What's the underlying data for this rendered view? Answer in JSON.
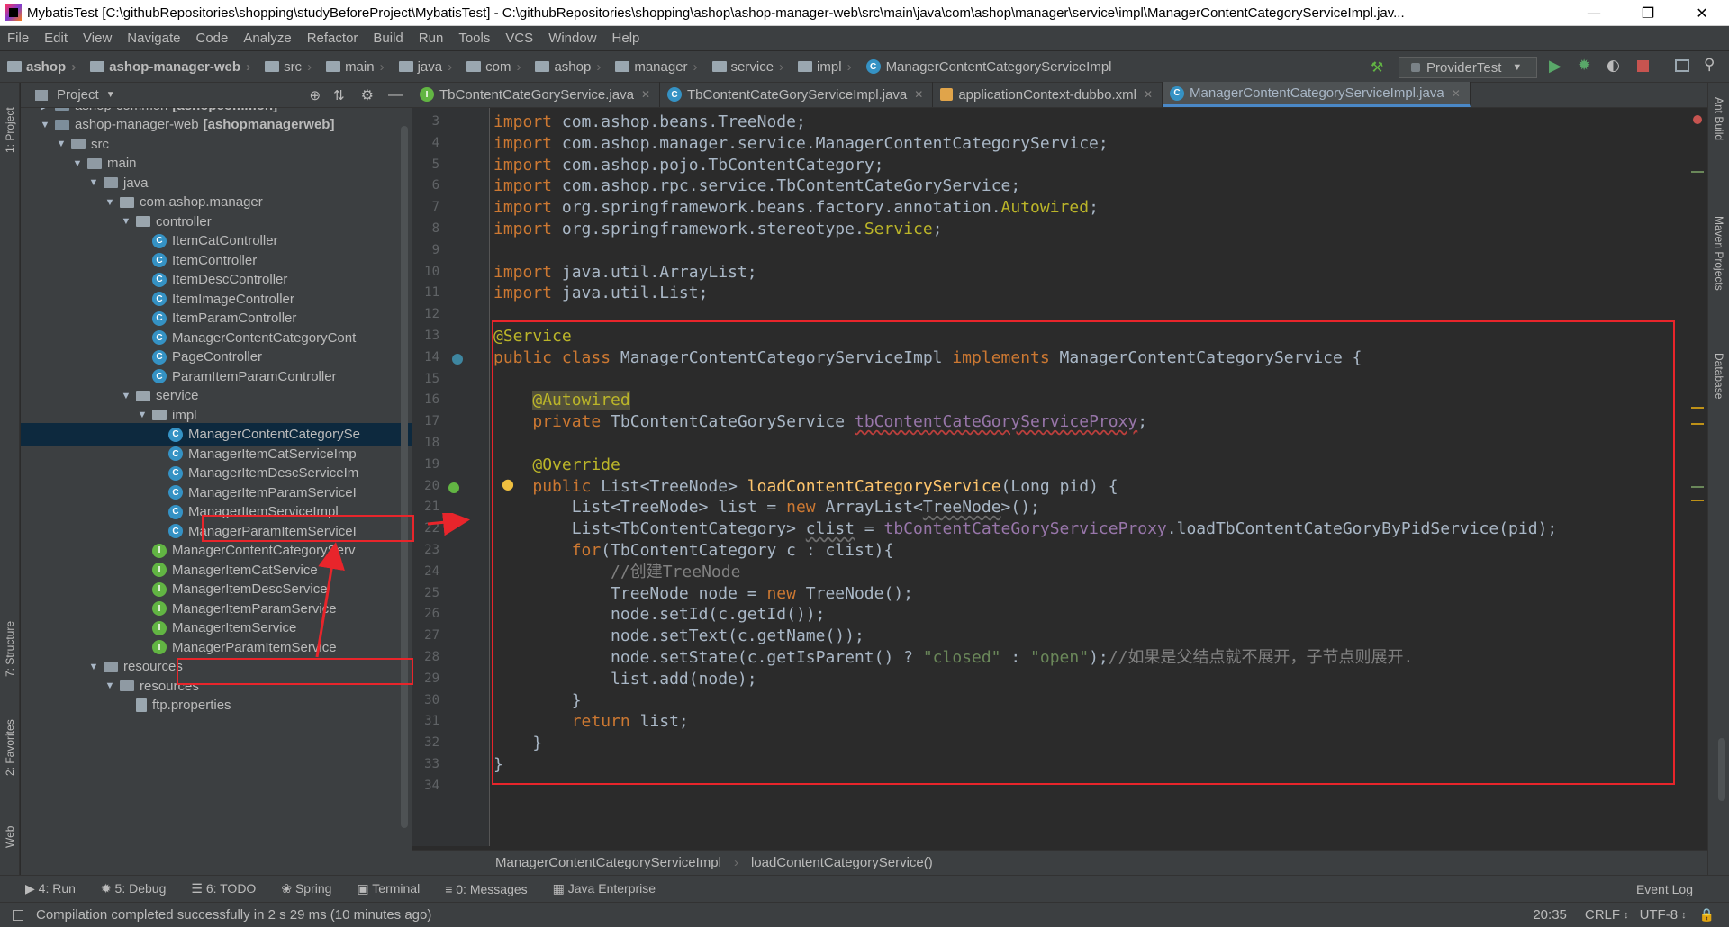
{
  "window": {
    "title": "MybatisTest [C:\\githubRepositories\\shopping\\studyBeforeProject\\MybatisTest] - C:\\githubRepositories\\shopping\\ashop\\ashop-manager-web\\src\\main\\java\\com\\ashop\\manager\\service\\impl\\ManagerContentCategoryServiceImpl.jav..."
  },
  "menu": [
    "File",
    "Edit",
    "View",
    "Navigate",
    "Code",
    "Analyze",
    "Refactor",
    "Build",
    "Run",
    "Tools",
    "VCS",
    "Window",
    "Help"
  ],
  "breadcrumbs": [
    "ashop",
    "ashop-manager-web",
    "src",
    "main",
    "java",
    "com",
    "ashop",
    "manager",
    "service",
    "impl",
    "ManagerContentCategoryServiceImpl"
  ],
  "run_config": "ProviderTest",
  "project_panel": {
    "title": "Project",
    "tree": [
      {
        "label": "ashop-common",
        "suffix": "[ashopcommon]",
        "depth": 0,
        "arrow": "right",
        "icon": "module"
      },
      {
        "label": "ashop-manager-web",
        "suffix": "[ashopmanagerweb]",
        "depth": 0,
        "arrow": "down",
        "icon": "module"
      },
      {
        "label": "src",
        "depth": 1,
        "arrow": "down",
        "icon": "folder"
      },
      {
        "label": "main",
        "depth": 2,
        "arrow": "down",
        "icon": "folder"
      },
      {
        "label": "java",
        "depth": 3,
        "arrow": "down",
        "icon": "folder"
      },
      {
        "label": "com.ashop.manager",
        "depth": 4,
        "arrow": "down",
        "icon": "package"
      },
      {
        "label": "controller",
        "depth": 5,
        "arrow": "down",
        "icon": "package"
      },
      {
        "label": "ItemCatController",
        "depth": 6,
        "icon": "class"
      },
      {
        "label": "ItemController",
        "depth": 6,
        "icon": "class"
      },
      {
        "label": "ItemDescController",
        "depth": 6,
        "icon": "class"
      },
      {
        "label": "ItemImageController",
        "depth": 6,
        "icon": "class"
      },
      {
        "label": "ItemParamController",
        "depth": 6,
        "icon": "class"
      },
      {
        "label": "ManagerContentCategoryCont",
        "depth": 6,
        "icon": "class"
      },
      {
        "label": "PageController",
        "depth": 6,
        "icon": "class"
      },
      {
        "label": "ParamItemParamController",
        "depth": 6,
        "icon": "class"
      },
      {
        "label": "service",
        "depth": 5,
        "arrow": "down",
        "icon": "package"
      },
      {
        "label": "impl",
        "depth": 6,
        "arrow": "down",
        "icon": "package"
      },
      {
        "label": "ManagerContentCategorySe",
        "depth": 7,
        "icon": "class",
        "selected": true
      },
      {
        "label": "ManagerItemCatServiceImp",
        "depth": 7,
        "icon": "class"
      },
      {
        "label": "ManagerItemDescServiceIm",
        "depth": 7,
        "icon": "class"
      },
      {
        "label": "ManagerItemParamServiceI",
        "depth": 7,
        "icon": "class"
      },
      {
        "label": "ManagerItemServiceImpl",
        "depth": 7,
        "icon": "class"
      },
      {
        "label": "ManagerParamItemServiceI",
        "depth": 7,
        "icon": "class"
      },
      {
        "label": "ManagerContentCategoryServ",
        "depth": 6,
        "icon": "interface"
      },
      {
        "label": "ManagerItemCatService",
        "depth": 6,
        "icon": "interface"
      },
      {
        "label": "ManagerItemDescService",
        "depth": 6,
        "icon": "interface"
      },
      {
        "label": "ManagerItemParamService",
        "depth": 6,
        "icon": "interface"
      },
      {
        "label": "ManagerItemService",
        "depth": 6,
        "icon": "interface"
      },
      {
        "label": "ManagerParamItemService",
        "depth": 6,
        "icon": "interface"
      },
      {
        "label": "resources",
        "depth": 3,
        "arrow": "down",
        "icon": "folder"
      },
      {
        "label": "resources",
        "depth": 4,
        "arrow": "down",
        "icon": "folder"
      },
      {
        "label": "ftp.properties",
        "depth": 5,
        "icon": "file"
      }
    ]
  },
  "tabs": [
    {
      "label": "TbContentCateGoryService.java",
      "icon": "interface"
    },
    {
      "label": "TbContentCateGoryServiceImpl.java",
      "icon": "class"
    },
    {
      "label": "applicationContext-dubbo.xml",
      "icon": "xml"
    },
    {
      "label": "ManagerContentCategoryServiceImpl.java",
      "icon": "class",
      "active": true
    }
  ],
  "code_lines": [
    {
      "n": "3",
      "html": "<span class='kw'>import</span> com.ashop.beans.TreeNode;"
    },
    {
      "n": "4",
      "html": "<span class='kw'>import</span> com.ashop.manager.service.ManagerContentCategoryService;"
    },
    {
      "n": "5",
      "html": "<span class='kw'>import</span> com.ashop.pojo.TbContentCategory;"
    },
    {
      "n": "6",
      "html": "<span class='kw'>import</span> com.ashop.rpc.service.TbContentCateGoryService;"
    },
    {
      "n": "7",
      "html": "<span class='kw'>import</span> org.springframework.beans.factory.annotation.<span class='an'>Autowired</span>;"
    },
    {
      "n": "8",
      "html": "<span class='kw'>import</span> org.springframework.stereotype.<span class='an'>Service</span>;"
    },
    {
      "n": "9",
      "html": ""
    },
    {
      "n": "10",
      "html": "<span class='kw'>import</span> java.util.ArrayList;"
    },
    {
      "n": "11",
      "html": "<span class='kw'>import</span> java.util.List;"
    },
    {
      "n": "12",
      "html": ""
    },
    {
      "n": "13",
      "html": "<span class='an'>@Service</span>"
    },
    {
      "n": "14",
      "html": "<span class='kw'>public class</span> ManagerContentCategoryServiceImpl <span class='kw'>implements</span> ManagerContentCategoryService {"
    },
    {
      "n": "15",
      "html": ""
    },
    {
      "n": "16",
      "html": "    <span class='an-hl'>@Autowired</span>"
    },
    {
      "n": "17",
      "html": "    <span class='kw'>private</span> TbContentCateGoryService <span class='fld'>tbContentCateGoryServiceProxy</span>;"
    },
    {
      "n": "18",
      "html": ""
    },
    {
      "n": "19",
      "html": "    <span class='an'>@Override</span>"
    },
    {
      "n": "20",
      "html": "    <span class='kw'>public</span> List&lt;TreeNode&gt; <span class='fn'>loadContentCategoryService</span>(Long pid) {"
    },
    {
      "n": "21",
      "html": "        List&lt;TreeNode&gt; list = <span class='kw'>new</span> ArrayList&lt;<span class='ul'>TreeNode</span>&gt;();"
    },
    {
      "n": "22",
      "html": "        List&lt;TbContentCategory&gt; <span class='ul'>clist</span> = <span class='fld' style='text-decoration:none'>tbContentCateGoryServiceProxy</span>.loadTbContentCateGoryByPidService(pid);"
    },
    {
      "n": "23",
      "html": "        <span class='kw'>for</span>(TbContentCategory c : clist){"
    },
    {
      "n": "24",
      "html": "            <span class='cmt'>//创建TreeNode</span>"
    },
    {
      "n": "25",
      "html": "            TreeNode node = <span class='kw'>new</span> TreeNode();"
    },
    {
      "n": "26",
      "html": "            node.setId(c.getId());"
    },
    {
      "n": "27",
      "html": "            node.setText(c.getName());"
    },
    {
      "n": "28",
      "html": "            node.setState(c.getIsParent() ? <span class='str'>\"closed\"</span> : <span class='str'>\"open\"</span>);<span class='cmt'>//如果是父结点就不展开，子节点则展开.</span>"
    },
    {
      "n": "29",
      "html": "            list.add(node);"
    },
    {
      "n": "30",
      "html": "        }"
    },
    {
      "n": "31",
      "html": "        <span class='kw'>return</span> list;"
    },
    {
      "n": "32",
      "html": "    }"
    },
    {
      "n": "33",
      "html": "}"
    },
    {
      "n": "34",
      "html": ""
    }
  ],
  "editor_breadcrumb": {
    "cls": "ManagerContentCategoryServiceImpl",
    "method": "loadContentCategoryService()"
  },
  "bottom_tools": [
    "4: Run",
    "5: Debug",
    "6: TODO",
    "Spring",
    "Terminal",
    "0: Messages",
    "Java Enterprise"
  ],
  "event_log": "Event Log",
  "status": {
    "message": "Compilation completed successfully in 2 s 29 ms (10 minutes ago)",
    "position": "20:35",
    "line_sep": "CRLF",
    "encoding": "UTF-8"
  },
  "side_tabs": {
    "left": [
      "1: Project",
      "7: Structure",
      "2: Favorites",
      "Web"
    ],
    "right": [
      "Ant Build",
      "Maven Projects",
      "Database"
    ]
  }
}
